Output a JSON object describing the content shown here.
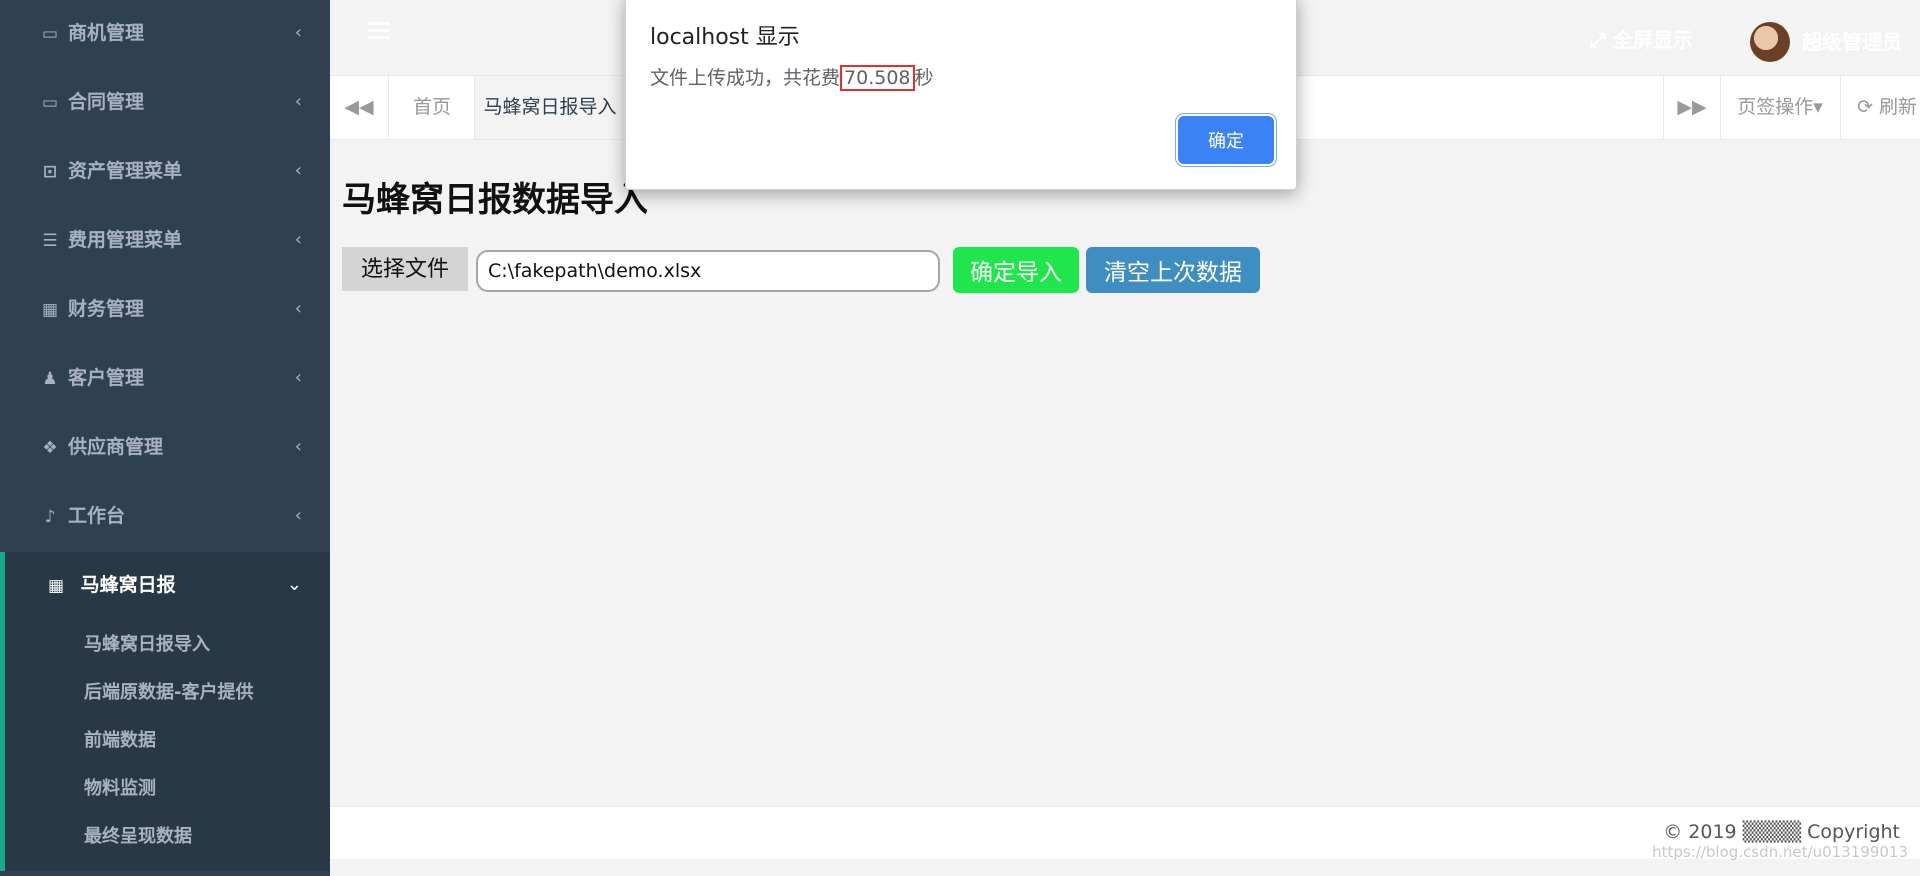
{
  "sidebar": {
    "items": [
      {
        "icon": "card-icon",
        "glyph": "▭",
        "label": "商机管理"
      },
      {
        "icon": "battery-icon",
        "glyph": "▭",
        "label": "合同管理"
      },
      {
        "icon": "money-icon",
        "glyph": "⊡",
        "label": "资产管理菜单"
      },
      {
        "icon": "database-icon",
        "glyph": "☰",
        "label": "费用管理菜单"
      },
      {
        "icon": "calculator-icon",
        "glyph": "▦",
        "label": "财务管理"
      },
      {
        "icon": "user-plus-icon",
        "glyph": "♟",
        "label": "客户管理"
      },
      {
        "icon": "cubes-icon",
        "glyph": "❖",
        "label": "供应商管理"
      },
      {
        "icon": "bell-icon",
        "glyph": "♪",
        "label": "工作台"
      }
    ],
    "active_group": {
      "icon": "calendar-icon",
      "glyph": "▦",
      "label": "马蜂窝日报",
      "children": [
        "马蜂窝日报导入",
        "后端原数据-客户提供",
        "前端数据",
        "物料监测",
        "最终呈现数据"
      ]
    }
  },
  "header": {
    "fullscreen_label": "全屏显示",
    "username": "超级管理员"
  },
  "tabs": {
    "home": "首页",
    "current": "马蜂窝日报导入",
    "ops": "页签操作▾",
    "refresh": "⟳ 刷新"
  },
  "main": {
    "title": "马蜂窝日报数据导入",
    "choose_file": "选择文件",
    "file_path": "C:\\fakepath\\demo.xlsx",
    "import_button": "确定导入",
    "clear_button": "清空上次数据"
  },
  "footer": {
    "copyright": "© 2019 ▒▒▒▒ Copyright",
    "watermark": "https://blog.csdn.net/u013199013"
  },
  "dialog": {
    "title": "localhost 显示",
    "message_prefix": "文件上传成功，共花费",
    "message_value": "70.508",
    "message_suffix": "秒",
    "ok_label": "确定"
  },
  "colors": {
    "sidebar_bg": "#2f4050",
    "sidebar_active_accent": "#19aa8d",
    "import_btn": "#1fe64a",
    "clear_btn": "#3e8ec2",
    "dialog_ok": "#3b82f6"
  }
}
